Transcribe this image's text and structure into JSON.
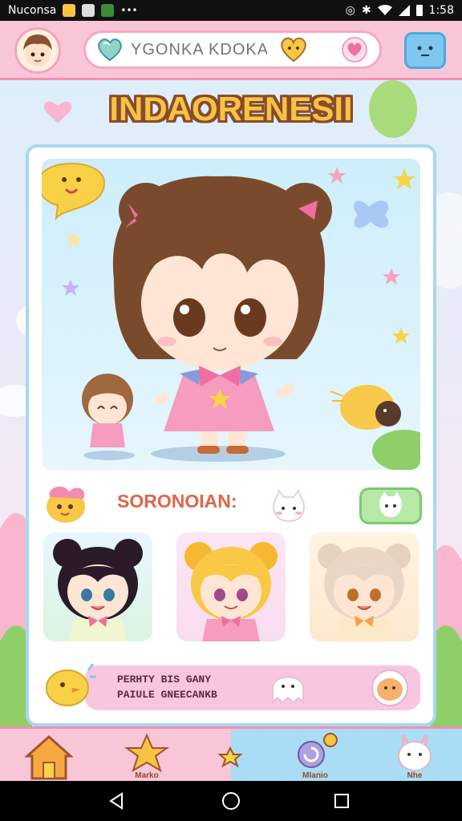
{
  "status_bar": {
    "carrier": "Nuconsa",
    "time": "1:58"
  },
  "header": {
    "search_placeholder": "YGONKA KDOKA"
  },
  "title": "INDAORENESII",
  "section": {
    "label": "SORONOIAN:"
  },
  "banner": {
    "line1": "PERHTY BIS GANY",
    "line2": "PAIULE GNEECANKB"
  },
  "bottom_nav": {
    "items": [
      {
        "label": "",
        "icon": "home-icon"
      },
      {
        "label": "Marko",
        "icon": "star-icon"
      },
      {
        "label": "",
        "icon": "sparkle-star-icon"
      },
      {
        "label": "Mlanio",
        "icon": "swirl-icon"
      },
      {
        "label": "Nhe",
        "icon": "bunny-icon"
      }
    ]
  },
  "colors": {
    "accent_pink": "#f9c6d8",
    "accent_blue": "#a9ddf5",
    "title_yellow": "#f6c343",
    "title_outline": "#8a4b2a",
    "label_red": "#e0644c"
  }
}
